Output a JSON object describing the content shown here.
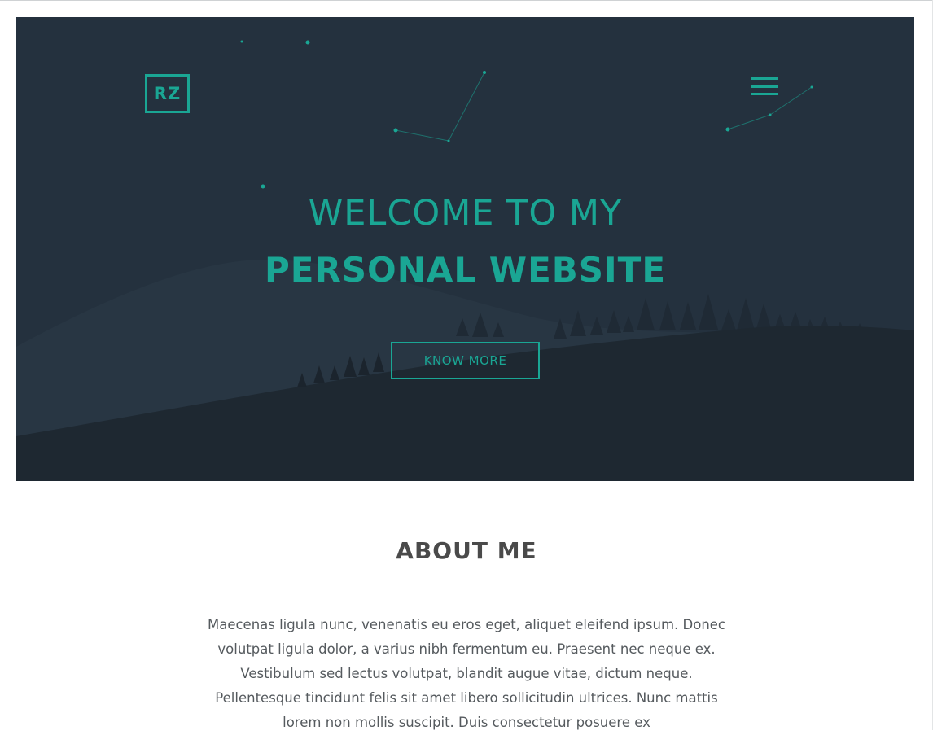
{
  "colors": {
    "accent": "#1aa694",
    "hero_background": "#24313e",
    "text_dark": "#4a4a4a",
    "text_body": "#555a5e"
  },
  "header": {
    "logo_text": "RZ",
    "menu_icon": "hamburger-menu-icon"
  },
  "hero": {
    "headline_line1": "WELCOME TO MY",
    "headline_line2": "PERSONAL WEBSITE",
    "cta_label": "KNOW MORE"
  },
  "about": {
    "title": "ABOUT ME",
    "body": "Maecenas ligula nunc, venenatis eu eros eget, aliquet eleifend ipsum. Donec volutpat ligula dolor, a varius nibh fermentum eu. Praesent nec neque ex. Vestibulum sed lectus volutpat, blandit augue vitae, dictum neque. Pellentesque tincidunt felis sit amet libero sollicitudin ultrices. Nunc mattis lorem non mollis suscipit. Duis consectetur posuere ex"
  }
}
